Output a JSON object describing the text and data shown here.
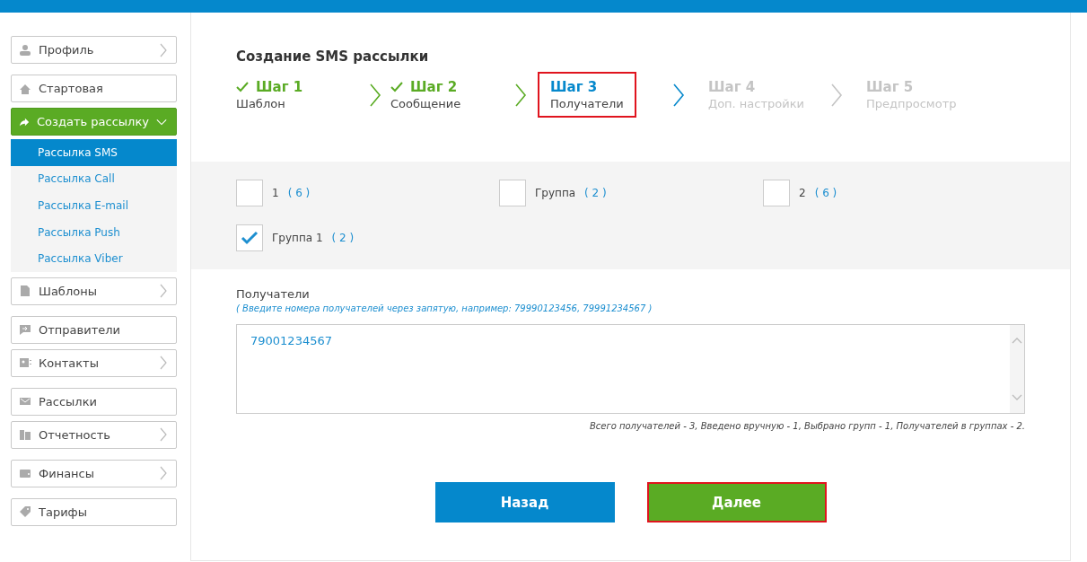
{
  "sidebar": {
    "groups": [
      [
        {
          "label": "Профиль",
          "expandable": true,
          "active": false
        }
      ],
      [
        {
          "label": "Стартовая",
          "expandable": false,
          "active": false
        },
        {
          "label": "Создать рассылку",
          "expandable": true,
          "active": true,
          "expanded": true,
          "children": [
            {
              "label": "Рассылка SMS",
              "selected": true
            },
            {
              "label": "Рассылка Call",
              "selected": false
            },
            {
              "label": "Рассылка E-mail",
              "selected": false
            },
            {
              "label": "Рассылка Push",
              "selected": false
            },
            {
              "label": "Рассылка Viber",
              "selected": false
            }
          ]
        },
        {
          "label": "Шаблоны",
          "expandable": true,
          "active": false
        }
      ],
      [
        {
          "label": "Отправители",
          "expandable": false,
          "active": false
        },
        {
          "label": "Контакты",
          "expandable": true,
          "active": false
        }
      ],
      [
        {
          "label": "Рассылки",
          "expandable": false,
          "active": false
        },
        {
          "label": "Отчетность",
          "expandable": true,
          "active": false
        }
      ],
      [
        {
          "label": "Финансы",
          "expandable": true,
          "active": false
        }
      ],
      [
        {
          "label": "Тарифы",
          "expandable": false,
          "active": false
        }
      ]
    ]
  },
  "title": "Создание SMS рассылки",
  "steps": [
    {
      "label": "Шаг 1",
      "caption": "Шаблон",
      "done": true,
      "current": false,
      "highlighted": false
    },
    {
      "label": "Шаг 2",
      "caption": "Сообщение",
      "done": true,
      "current": false,
      "highlighted": false
    },
    {
      "label": "Шаг 3",
      "caption": "Получатели",
      "done": false,
      "current": true,
      "highlighted": true
    },
    {
      "label": "Шаг 4",
      "caption": "Доп. настройки",
      "done": false,
      "current": false,
      "highlighted": false
    },
    {
      "label": "Шаг 5",
      "caption": "Предпросмотр",
      "done": false,
      "current": false,
      "highlighted": false
    }
  ],
  "groups": [
    {
      "name": "1",
      "count": "( 6 )",
      "checked": false
    },
    {
      "name": "Группа",
      "count": "( 2 )",
      "checked": false
    },
    {
      "name": "2",
      "count": "( 6 )",
      "checked": false
    },
    {
      "name": "Группа 1",
      "count": "( 2 )",
      "checked": true
    }
  ],
  "recipients": {
    "label": "Получатели",
    "hint": "( Введите номера получателей через запятую, например: 79990123456, 79991234567 )",
    "value": "79001234567",
    "summary": "Всего получателей - 3, Введено вручную - 1, Выбрано групп - 1, Получателей в группах - 2."
  },
  "buttons": [
    {
      "label": "Назад",
      "kind": "back",
      "highlighted": false
    },
    {
      "label": "Далее",
      "kind": "next",
      "highlighted": true
    }
  ]
}
